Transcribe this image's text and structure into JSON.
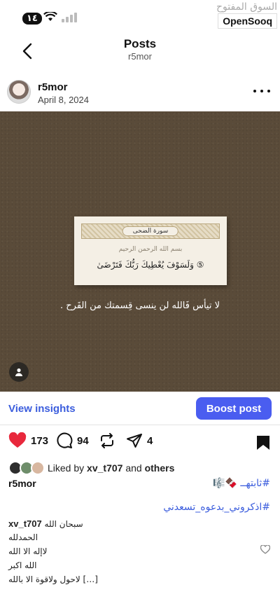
{
  "status_bar": {
    "time": "١٤"
  },
  "brand": {
    "arabic": "السوق المفتوح",
    "english": "OpenSooq"
  },
  "header": {
    "title": "Posts",
    "subtitle": "r5mor"
  },
  "post": {
    "username": "r5mor",
    "date": "April 8, 2024",
    "image": {
      "band_label": "سورة الضحى",
      "basmala": "بسم الله الرحمن الرحيم",
      "verse": "وَلَسَوْفَ يُعْطِيكَ رَبُّكَ فَتَرْضَىٰ ⑤",
      "overlay_text": "لا تيأس فَالله لن ينسى قِسمتك من الفَرح ."
    }
  },
  "insights": {
    "view_label": "View insights",
    "boost_label": "Boost post"
  },
  "actions": {
    "likes": "173",
    "comments": "94",
    "shares": "4"
  },
  "liked_by": {
    "prefix": "Liked by",
    "user": "xv_t707",
    "connector": "and",
    "others": "others"
  },
  "caption": {
    "username": "r5mor",
    "tag1": "#ثابتهــ 🍫🎼",
    "tag2": "#اذكروني_بدعوه_تسعدني"
  },
  "comment": {
    "username": "xv_t707",
    "lines": [
      "سبحان الله",
      "الحمدلله",
      "لاإله الا الله",
      "الله اكبر",
      "لاحول ولاقوة الا بالله […]"
    ]
  },
  "colors": {
    "accent": "#4a5df0",
    "link": "#3b5ddd",
    "like": "#e8283c",
    "photo_bg": "#5a4b39"
  }
}
